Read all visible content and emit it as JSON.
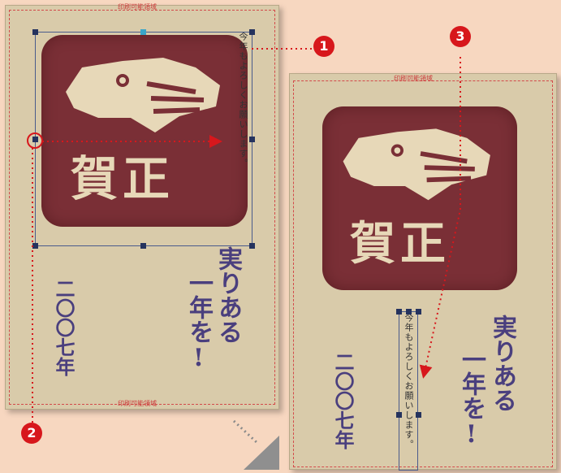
{
  "markers": [
    "1",
    "2",
    "3"
  ],
  "printable_label": "印刷可能領域",
  "stamp_text": "賀正",
  "year_text": "二〇〇七年",
  "slogan_col1": "実りある",
  "slogan_col2": "一年を!",
  "greeting": "今年もよろしくお願いします。",
  "colors": {
    "background": "#f7d7c0",
    "card": "#d9cbaa",
    "stamp": "#7a2f36",
    "brush_ink": "#4a3f7e",
    "marker": "#d7171c",
    "selection": "#25335e"
  }
}
